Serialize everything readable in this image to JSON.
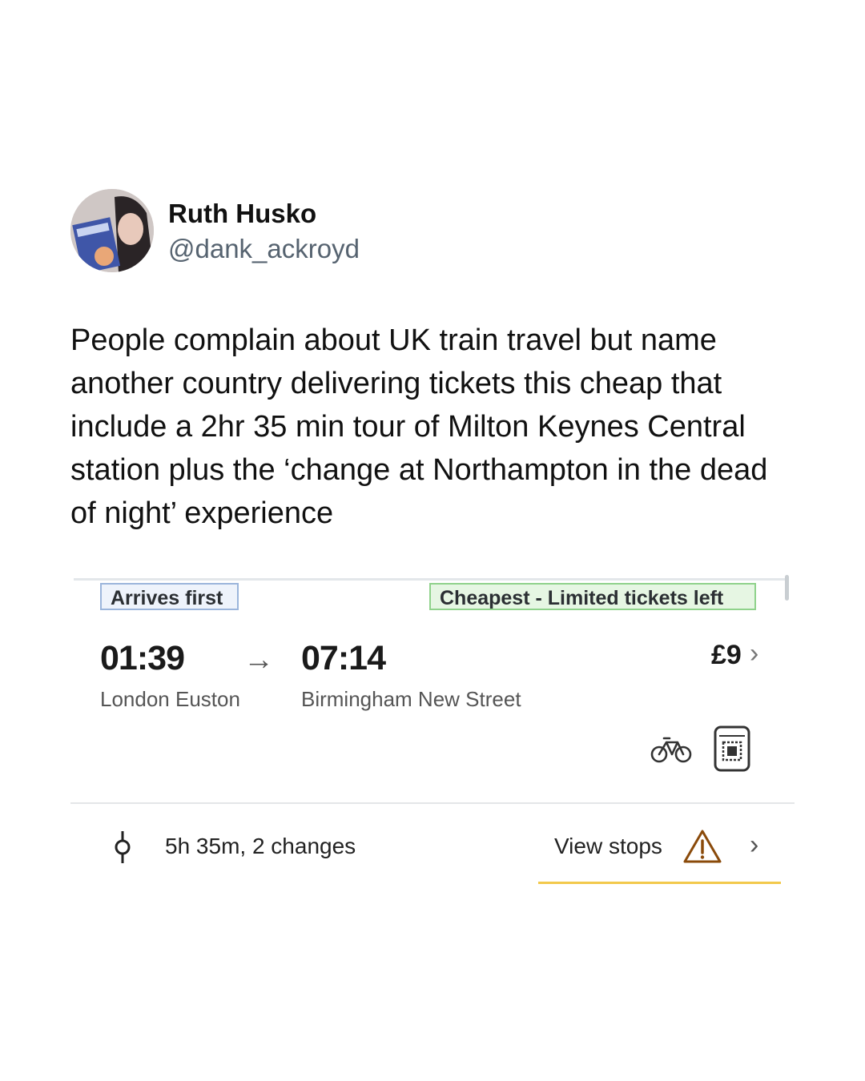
{
  "tweet": {
    "author_name": "Ruth Husko",
    "author_handle": "@dank_ackroyd",
    "text": "People complain about UK train travel but name another country delivering tickets this cheap that include a 2hr 35 min tour of Milton Keynes Central station plus the ‘change at Northampton in the dead of night’ experience"
  },
  "journey": {
    "badge_left": "Arrives first",
    "badge_right": "Cheapest - Limited tickets left",
    "depart_time": "01:39",
    "arrow": "→",
    "arrive_time": "07:14",
    "depart_station": "London Euston",
    "arrive_station": "Birmingham New Street",
    "price": "£9",
    "price_chevron": "›",
    "duration_changes": "5h 35m, 2 changes",
    "view_stops": "View stops",
    "stops_chevron": "›",
    "icons": [
      "avatar",
      "bicycle-icon",
      "wifi-router-icon",
      "journey-line-icon",
      "warning-icon"
    ]
  },
  "colors": {
    "badge_blue_border": "#9bb5db",
    "badge_green_border": "#8fd28b",
    "warning_accent": "#f2c94c"
  }
}
